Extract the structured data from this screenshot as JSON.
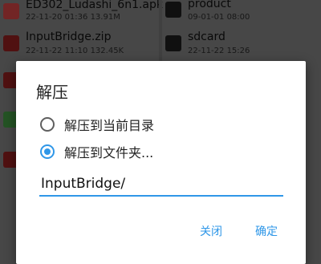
{
  "file_list": {
    "left": [
      {
        "name": "ED302_Ludashi_6n1.apk",
        "meta": "22-11-20 01:36  13.91M",
        "icon": "apk-icon",
        "color": "#c44141"
      },
      {
        "name": "InputBridge.zip",
        "meta": "22-11-22 11:10  132.45K",
        "icon": "zip-icon",
        "color": "#8a1e1e"
      },
      {
        "name": "",
        "meta": "",
        "icon": "zip-icon",
        "color": "#8a1e1e"
      },
      {
        "name": "",
        "meta": "",
        "icon": "excel-icon",
        "color": "#3f8f3f"
      },
      {
        "name": "",
        "meta": "",
        "icon": "zip-icon",
        "color": "#8a1e1e"
      }
    ],
    "right": [
      {
        "name": "product",
        "meta": "09-01-01 08:00",
        "icon": "folder-icon",
        "color": "#1c1c1c"
      },
      {
        "name": "sdcard",
        "meta": "22-11-22 15:26",
        "icon": "folder-icon",
        "color": "#1c1c1c"
      }
    ]
  },
  "dialog": {
    "title": "解压",
    "options": [
      {
        "label": "解压到当前目录",
        "checked": false
      },
      {
        "label": "解压到文件夹...",
        "checked": true
      }
    ],
    "path_value": "InputBridge/",
    "cancel_label": "关闭",
    "ok_label": "确定"
  },
  "colors": {
    "accent": "#2f97e8"
  }
}
